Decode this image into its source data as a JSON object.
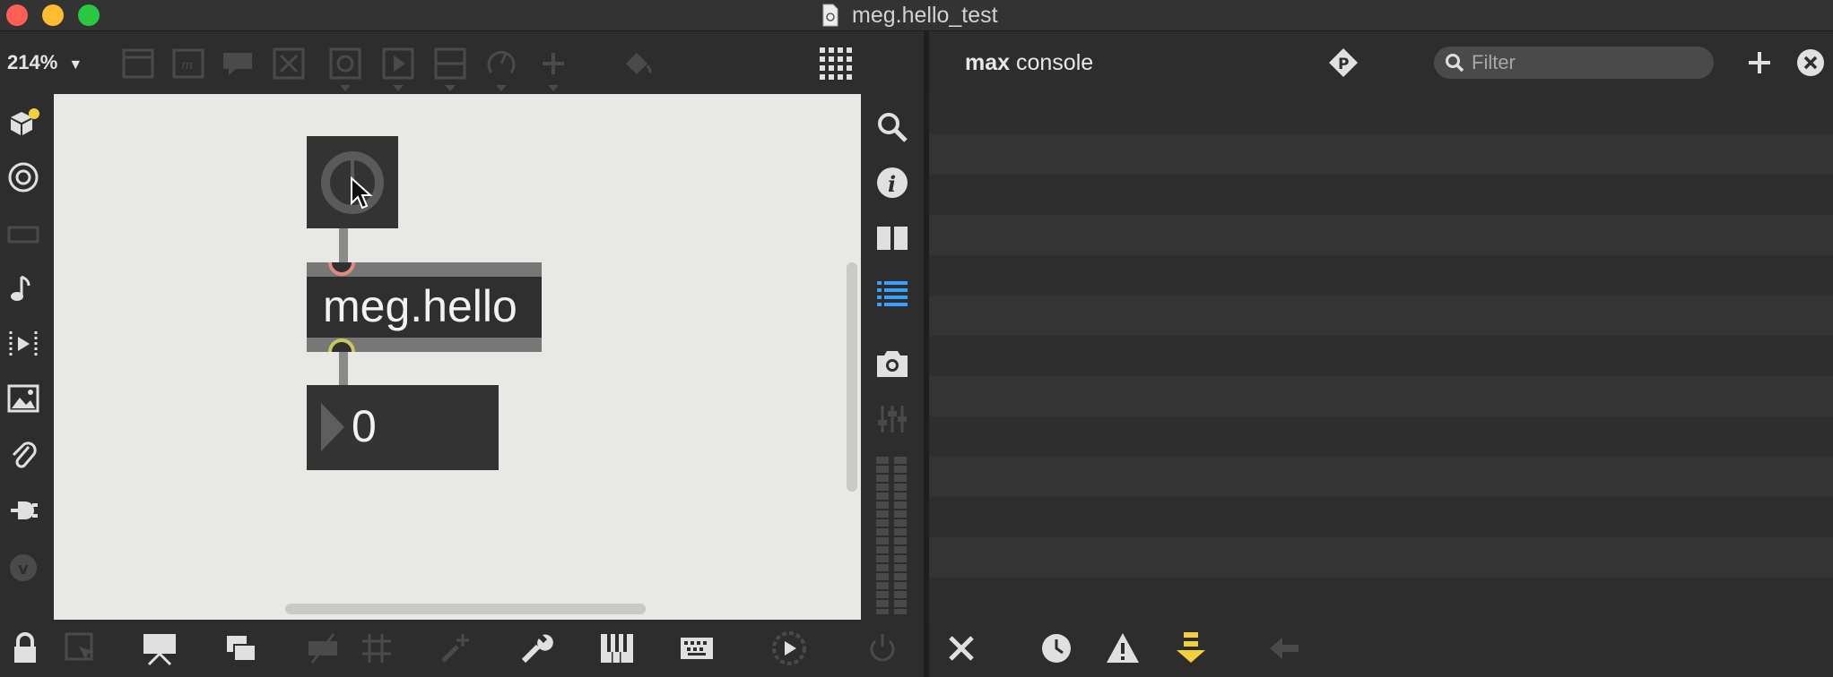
{
  "window": {
    "title": "meg.hello_test",
    "traffic_lights": {
      "close": "#ff5f57",
      "minimize": "#febc2e",
      "zoom": "#28c840"
    }
  },
  "toolbar": {
    "zoom_label": "214%",
    "icons": [
      "bpatcher-icon",
      "message-icon",
      "comment-icon",
      "toggle-icon",
      "button-icon",
      "play-icon",
      "slider-icon",
      "dial-icon",
      "plus-icon",
      "paint-bucket-icon",
      "grid-icon"
    ]
  },
  "left_sidebar": {
    "icons": [
      "package-icon",
      "target-icon",
      "keyboard-icon",
      "music-note-icon",
      "video-icon",
      "image-icon",
      "paperclip-icon",
      "plug-icon",
      "vimeo-icon"
    ]
  },
  "patcher": {
    "object_name": "meg.hello",
    "number_value": "0",
    "inlet_color": "#e08a80",
    "outlet_color": "#c8c860"
  },
  "right_palette": {
    "icons": [
      "search-icon",
      "info-icon",
      "columns-icon",
      "list-icon",
      "camera-icon",
      "mixer-icon",
      "level-meter-icon"
    ],
    "active_color": "#3aa0ff"
  },
  "console": {
    "title_bold": "max",
    "title_rest": "console",
    "filter_placeholder": "Filter"
  },
  "bottom_bar": {
    "icons": [
      "lock-icon",
      "select-icon",
      "presentation-icon",
      "layers-icon",
      "hide-icon",
      "grid-icon",
      "add-icon",
      "wrench-icon",
      "piano-icon",
      "keyboard-icon",
      "audio-icon",
      "power-icon"
    ]
  },
  "console_bottom": {
    "icons": [
      "clear-icon",
      "clock-icon",
      "warning-icon",
      "scroll-down-icon",
      "back-arrow-icon"
    ],
    "highlight_color": "#f4d03f"
  }
}
